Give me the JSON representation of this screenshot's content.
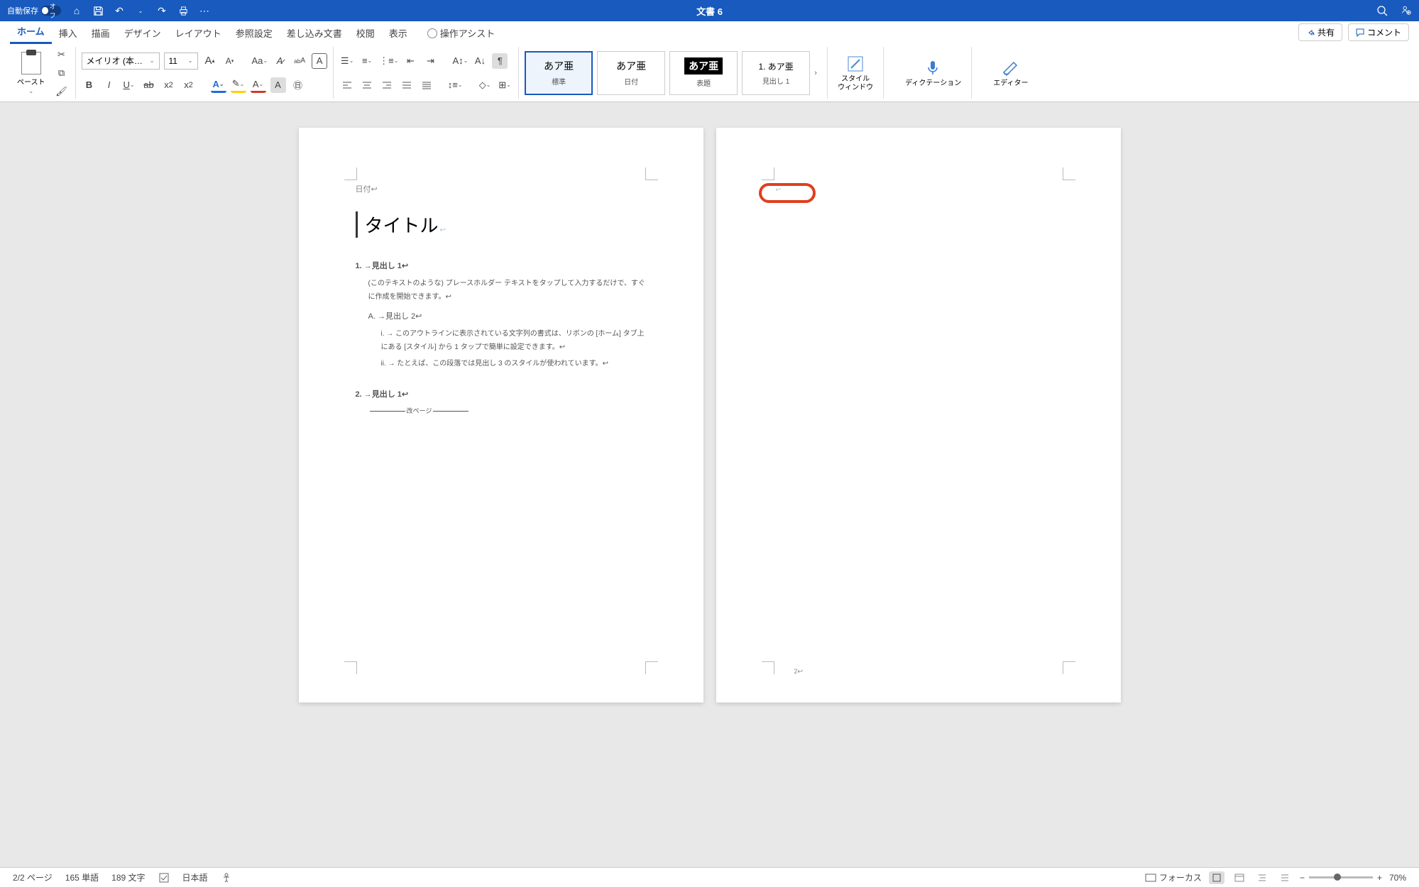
{
  "titlebar": {
    "autosave_label": "自動保存",
    "autosave_state": "オフ",
    "doc_title": "文書 6"
  },
  "tabs": {
    "items": [
      "ホーム",
      "挿入",
      "描画",
      "デザイン",
      "レイアウト",
      "参照設定",
      "差し込み文書",
      "校閲",
      "表示"
    ],
    "active_index": 0,
    "assist": "操作アシスト",
    "share": "共有",
    "comment": "コメント"
  },
  "ribbon": {
    "paste_label": "ペースト",
    "font_name": "メイリオ (本…",
    "font_size": "11",
    "styles": [
      {
        "sample": "あア亜",
        "label": "標準",
        "selected": true,
        "sample_style": ""
      },
      {
        "sample": "あア亜",
        "label": "日付",
        "selected": false,
        "sample_style": ""
      },
      {
        "sample": "あア亜",
        "label": "表題",
        "selected": false,
        "sample_style": "bg"
      },
      {
        "sample": "1. あア亜",
        "label": "見出し 1",
        "selected": false,
        "sample_style": ""
      }
    ],
    "styles_pane": "スタイル\nウィンドウ",
    "dictation": "ディクテーション",
    "editor": "エディター"
  },
  "document": {
    "page1": {
      "date_label": "日付↩",
      "title": "タイトル",
      "h1_a": "1. →見出し 1↩",
      "body1": "(このテキストのような) プレースホルダー テキストをタップして入力するだけで、すぐに作成を開始できます。↩",
      "h2_a": "A. →見出し 2↩",
      "li1": "i.  → このアウトラインに表示されている文字列の書式は、リボンの [ホーム] タブ上にある [スタイル] から 1 タップで簡単に設定できます。↩",
      "li2": "ii. → たとえば、この段落では見出し 3 のスタイルが使われています。↩",
      "h1_b": "2. →見出し 1↩",
      "pagebreak": "改ページ"
    },
    "page2": {
      "page_number": "2↩"
    }
  },
  "statusbar": {
    "pages": "2/2 ページ",
    "words": "165 単語",
    "chars": "189 文字",
    "lang": "日本語",
    "focus": "フォーカス",
    "zoom": "70%"
  },
  "colors": {
    "brand": "#185abd",
    "annotation": "#e03f1e"
  }
}
